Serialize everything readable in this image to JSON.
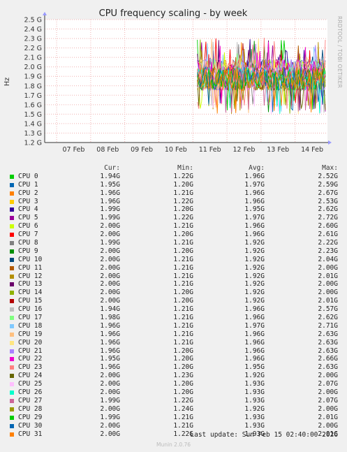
{
  "chart_data": {
    "type": "line",
    "title": "CPU frequency scaling - by week",
    "ylabel": "Hz",
    "side_label": "RRDTOOL / TOBI OETIKER",
    "ylim": [
      1.2,
      2.5
    ],
    "yticks": [
      "1.2 G",
      "1.3 G",
      "1.4 G",
      "1.5 G",
      "1.6 G",
      "1.7 G",
      "1.8 G",
      "1.9 G",
      "2.0 G",
      "2.1 G",
      "2.2 G",
      "2.3 G",
      "2.4 G",
      "2.5 G"
    ],
    "xticks": [
      "07 Feb",
      "08 Feb",
      "09 Feb",
      "10 Feb",
      "11 Feb",
      "12 Feb",
      "13 Feb",
      "14 Feb"
    ],
    "data_start_fraction": 0.54,
    "series_band": {
      "low": 1.65,
      "high": 2.0,
      "spike_max": 2.31,
      "dip_min": 1.5
    },
    "grid": true
  },
  "legend": {
    "headers": [
      "Cur:",
      "Min:",
      "Avg:",
      "Max:"
    ],
    "rows": [
      {
        "name": "CPU 0",
        "color": "#00cc00",
        "cur": "1.94G",
        "min": "1.22G",
        "avg": "1.96G",
        "max": "2.52G"
      },
      {
        "name": "CPU 1",
        "color": "#0066b3",
        "cur": "1.95G",
        "min": "1.20G",
        "avg": "1.97G",
        "max": "2.59G"
      },
      {
        "name": "CPU 2",
        "color": "#ff8000",
        "cur": "1.96G",
        "min": "1.21G",
        "avg": "1.96G",
        "max": "2.67G"
      },
      {
        "name": "CPU 3",
        "color": "#ffcc00",
        "cur": "1.96G",
        "min": "1.22G",
        "avg": "1.96G",
        "max": "2.53G"
      },
      {
        "name": "CPU 4",
        "color": "#330099",
        "cur": "1.99G",
        "min": "1.20G",
        "avg": "1.95G",
        "max": "2.62G"
      },
      {
        "name": "CPU 5",
        "color": "#990099",
        "cur": "1.99G",
        "min": "1.22G",
        "avg": "1.97G",
        "max": "2.72G"
      },
      {
        "name": "CPU 6",
        "color": "#ccff00",
        "cur": "2.00G",
        "min": "1.21G",
        "avg": "1.96G",
        "max": "2.60G"
      },
      {
        "name": "CPU 7",
        "color": "#ff0000",
        "cur": "2.00G",
        "min": "1.20G",
        "avg": "1.96G",
        "max": "2.61G"
      },
      {
        "name": "CPU 8",
        "color": "#808080",
        "cur": "1.99G",
        "min": "1.21G",
        "avg": "1.92G",
        "max": "2.22G"
      },
      {
        "name": "CPU 9",
        "color": "#008f00",
        "cur": "2.00G",
        "min": "1.20G",
        "avg": "1.92G",
        "max": "2.23G"
      },
      {
        "name": "CPU 10",
        "color": "#00487d",
        "cur": "2.00G",
        "min": "1.21G",
        "avg": "1.92G",
        "max": "2.04G"
      },
      {
        "name": "CPU 11",
        "color": "#b35a00",
        "cur": "2.00G",
        "min": "1.21G",
        "avg": "1.92G",
        "max": "2.00G"
      },
      {
        "name": "CPU 12",
        "color": "#b38f00",
        "cur": "2.00G",
        "min": "1.21G",
        "avg": "1.92G",
        "max": "2.01G"
      },
      {
        "name": "CPU 13",
        "color": "#6b006b",
        "cur": "2.00G",
        "min": "1.21G",
        "avg": "1.92G",
        "max": "2.00G"
      },
      {
        "name": "CPU 14",
        "color": "#8fb300",
        "cur": "2.00G",
        "min": "1.20G",
        "avg": "1.92G",
        "max": "2.00G"
      },
      {
        "name": "CPU 15",
        "color": "#b30000",
        "cur": "2.00G",
        "min": "1.20G",
        "avg": "1.92G",
        "max": "2.01G"
      },
      {
        "name": "CPU 16",
        "color": "#bebebe",
        "cur": "1.94G",
        "min": "1.21G",
        "avg": "1.96G",
        "max": "2.57G"
      },
      {
        "name": "CPU 17",
        "color": "#80ff80",
        "cur": "1.98G",
        "min": "1.21G",
        "avg": "1.96G",
        "max": "2.62G"
      },
      {
        "name": "CPU 18",
        "color": "#80c9ff",
        "cur": "1.96G",
        "min": "1.21G",
        "avg": "1.97G",
        "max": "2.71G"
      },
      {
        "name": "CPU 19",
        "color": "#ffc080",
        "cur": "1.96G",
        "min": "1.21G",
        "avg": "1.96G",
        "max": "2.63G"
      },
      {
        "name": "CPU 20",
        "color": "#ffe680",
        "cur": "1.96G",
        "min": "1.21G",
        "avg": "1.96G",
        "max": "2.63G"
      },
      {
        "name": "CPU 21",
        "color": "#aa80ff",
        "cur": "1.96G",
        "min": "1.20G",
        "avg": "1.96G",
        "max": "2.63G"
      },
      {
        "name": "CPU 22",
        "color": "#ee00cc",
        "cur": "1.95G",
        "min": "1.20G",
        "avg": "1.96G",
        "max": "2.66G"
      },
      {
        "name": "CPU 23",
        "color": "#ff8080",
        "cur": "1.96G",
        "min": "1.20G",
        "avg": "1.95G",
        "max": "2.63G"
      },
      {
        "name": "CPU 24",
        "color": "#666600",
        "cur": "2.00G",
        "min": "1.23G",
        "avg": "1.92G",
        "max": "2.00G"
      },
      {
        "name": "CPU 25",
        "color": "#ffbfff",
        "cur": "2.00G",
        "min": "1.20G",
        "avg": "1.93G",
        "max": "2.07G"
      },
      {
        "name": "CPU 26",
        "color": "#00ffcc",
        "cur": "2.00G",
        "min": "1.20G",
        "avg": "1.93G",
        "max": "2.00G"
      },
      {
        "name": "CPU 27",
        "color": "#cc6699",
        "cur": "1.99G",
        "min": "1.22G",
        "avg": "1.93G",
        "max": "2.07G"
      },
      {
        "name": "CPU 28",
        "color": "#999900",
        "cur": "2.00G",
        "min": "1.24G",
        "avg": "1.92G",
        "max": "2.00G"
      },
      {
        "name": "CPU 29",
        "color": "#00cc00",
        "cur": "1.99G",
        "min": "1.21G",
        "avg": "1.93G",
        "max": "2.01G"
      },
      {
        "name": "CPU 30",
        "color": "#0066b3",
        "cur": "2.00G",
        "min": "1.21G",
        "avg": "1.93G",
        "max": "2.00G"
      },
      {
        "name": "CPU 31",
        "color": "#ff8000",
        "cur": "2.00G",
        "min": "1.22G",
        "avg": "1.93G",
        "max": "2.01G"
      }
    ]
  },
  "last_update": "Last update: Sun Feb 15 02:40:00 2026",
  "footer": "Munin 2.0.76"
}
